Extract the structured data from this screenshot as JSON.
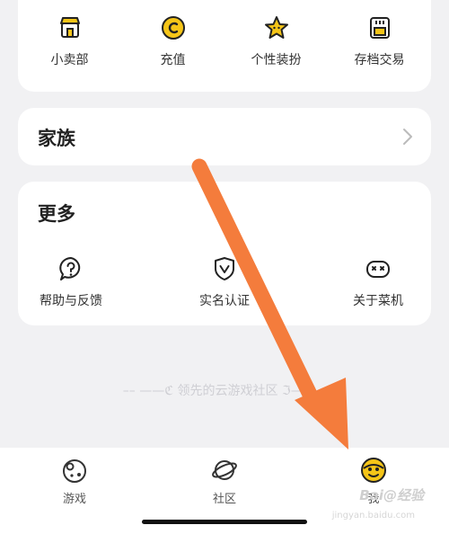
{
  "shortcuts": [
    {
      "label": "小卖部",
      "icon": "shop-icon"
    },
    {
      "label": "充值",
      "icon": "coin-icon"
    },
    {
      "label": "个性装扮",
      "icon": "star-face-icon"
    },
    {
      "label": "存档交易",
      "icon": "save-card-icon"
    }
  ],
  "family": {
    "title": "家族",
    "icon": "chevron-right-icon"
  },
  "more": {
    "title": "更多",
    "items": [
      {
        "label": "帮助与反馈",
        "icon": "help-icon"
      },
      {
        "label": "实名认证",
        "icon": "verify-shield-icon"
      },
      {
        "label": "关于菜机",
        "icon": "robot-face-icon"
      }
    ]
  },
  "slogan": "领先的云游戏社区",
  "tabs": [
    {
      "label": "游戏",
      "icon": "game-icon",
      "active": false
    },
    {
      "label": "社区",
      "icon": "planet-icon",
      "active": false
    },
    {
      "label": "我",
      "icon": "avatar-face-icon",
      "active": true
    }
  ],
  "watermark": {
    "brand": "Bai@经验",
    "url": "jingyan.baidu.com"
  },
  "colors": {
    "accent": "#f5c518",
    "arrow": "#f47c3c",
    "background": "#f1f1f3"
  }
}
